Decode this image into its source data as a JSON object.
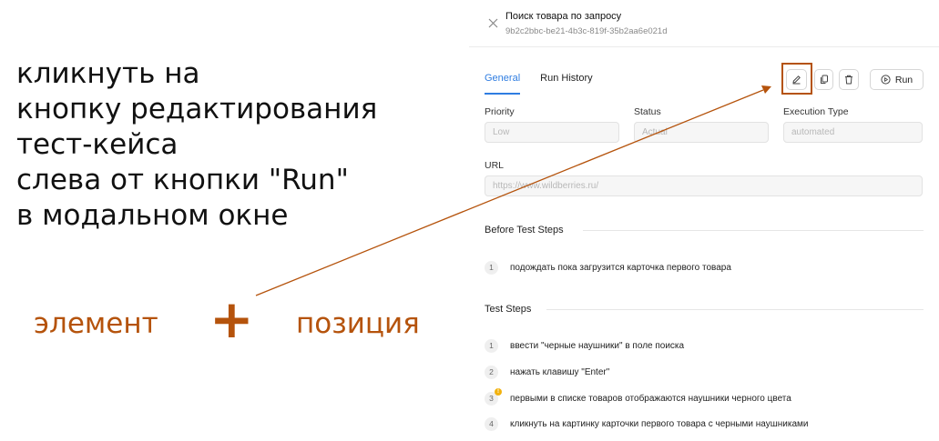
{
  "annotation": {
    "instruction_lines": [
      "кликнуть на",
      "кнопку редактирования",
      "тест-кейса",
      "слева от кнопки \"Run\"",
      "в модальном окне"
    ],
    "element_label": "элемент",
    "plus": "+",
    "position_label": "позиция",
    "accent_color": "#b5530c"
  },
  "modal": {
    "title": "Поиск товара по запросу",
    "id": "9b2c2bbc-be21-4b3c-819f-35b2aa6e021d",
    "tabs": [
      {
        "label": "General",
        "active": true
      },
      {
        "label": "Run History",
        "active": false
      }
    ],
    "toolbar": {
      "edit_icon": "pencil-icon",
      "copy_icon": "copy-icon",
      "delete_icon": "trash-icon",
      "run_icon": "play-circle-icon",
      "run_label": "Run"
    },
    "fields": {
      "priority": {
        "label": "Priority",
        "value": "Low"
      },
      "status": {
        "label": "Status",
        "value": "Actual"
      },
      "execution_type": {
        "label": "Execution Type",
        "value": "automated"
      },
      "url": {
        "label": "URL",
        "value": "https://www.wildberries.ru/"
      }
    },
    "before_steps": {
      "title": "Before Test Steps",
      "items": [
        {
          "num": "1",
          "text": "подождать пока загрузится карточка первого товара"
        }
      ]
    },
    "test_steps": {
      "title": "Test Steps",
      "items": [
        {
          "num": "1",
          "text": "ввести \"черные наушники\" в поле поиска"
        },
        {
          "num": "2",
          "text": "нажать клавишу \"Enter\""
        },
        {
          "num": "3",
          "text": "первыми в списке товаров отображаются наушники черного цвета",
          "badge": "warning-icon"
        },
        {
          "num": "4",
          "text": "кликнуть на картинку карточки первого товара с черными наушниками"
        }
      ]
    },
    "accent_color": "#2f7de1"
  }
}
